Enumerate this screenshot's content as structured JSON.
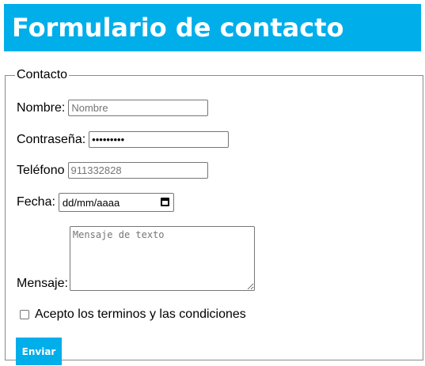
{
  "header": {
    "title": "Formulario de contacto",
    "background_color": "#00aeea"
  },
  "form": {
    "legend": "Contacto",
    "nombre": {
      "label": "Nombre:",
      "placeholder": "Nombre",
      "value": ""
    },
    "contrasena": {
      "label": "Contraseña:",
      "value": "•••••••••"
    },
    "telefono": {
      "label": "Teléfono",
      "placeholder": "911332828",
      "value": ""
    },
    "fecha": {
      "label": "Fecha:",
      "value": "dd/mm/aaaa",
      "icon": "calendar-icon"
    },
    "mensaje": {
      "label": "Mensaje:",
      "placeholder": "Mensaje de texto"
    },
    "terminos": {
      "label": "Acepto los terminos y las condiciones",
      "checked": false
    },
    "submit": {
      "label": "Enviar",
      "color": "#00aeea"
    }
  }
}
